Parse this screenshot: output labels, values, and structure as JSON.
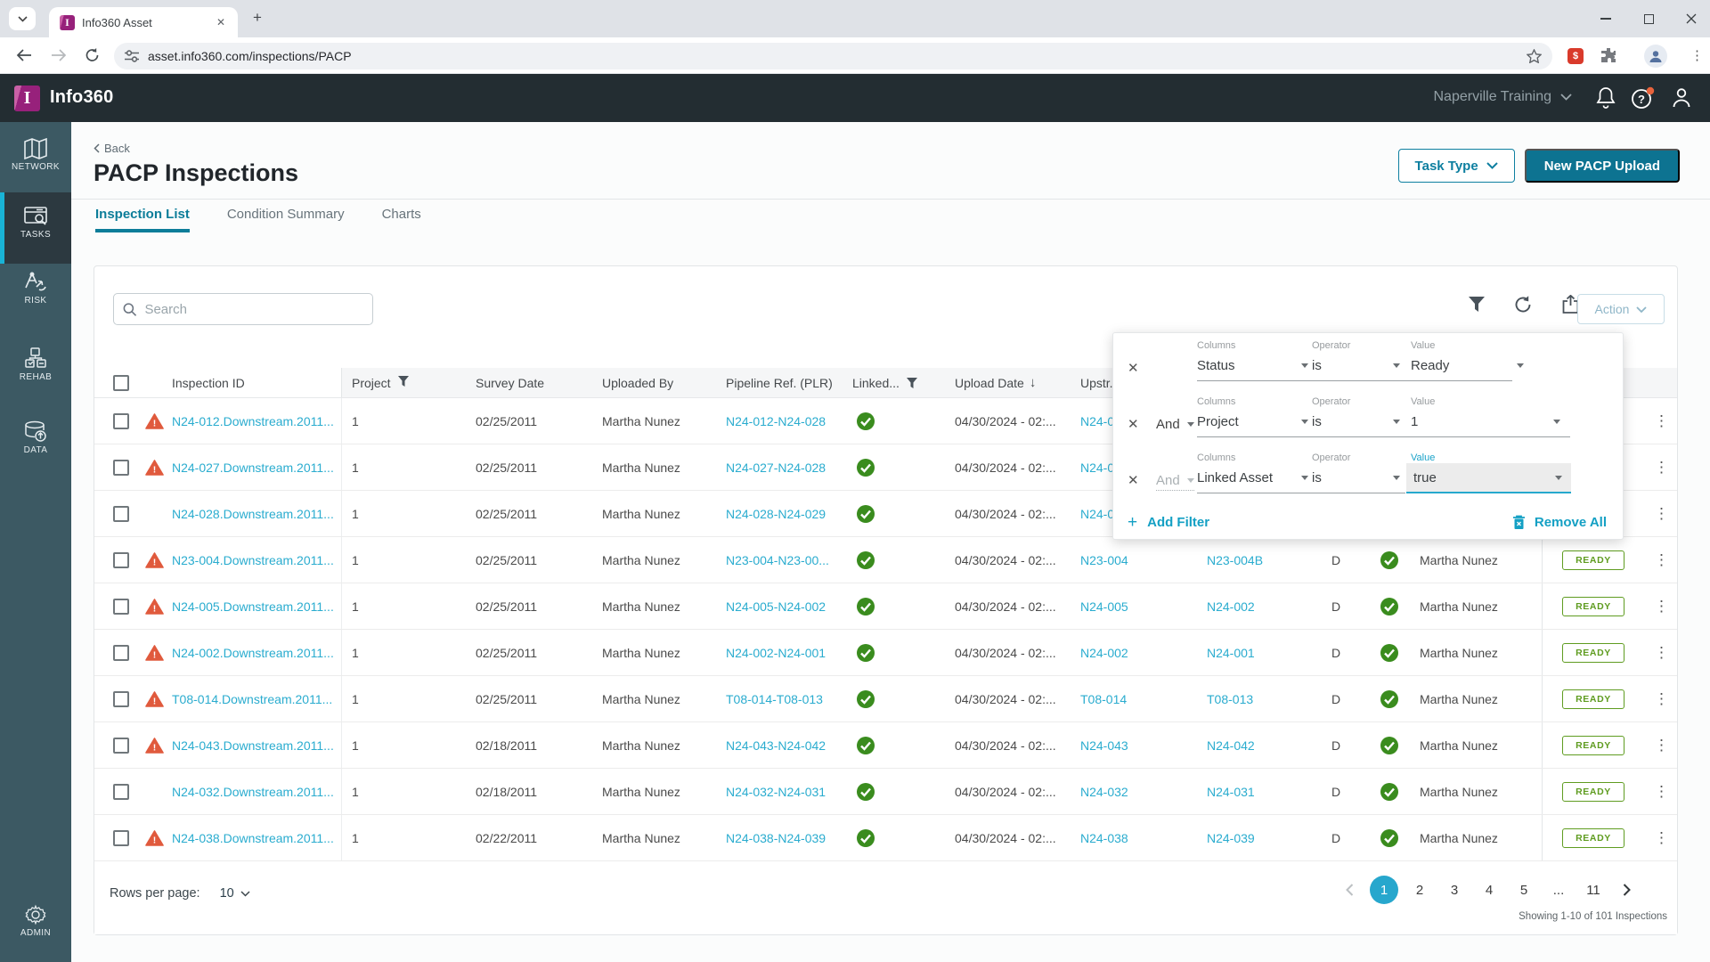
{
  "browser": {
    "tab_title": "Info360 Asset",
    "url": "asset.info360.com/inspections/PACP"
  },
  "header": {
    "brand": "Info360",
    "org": "Naperville Training"
  },
  "sidebar": {
    "items": [
      {
        "label": "NETWORK",
        "active": false
      },
      {
        "label": "TASKS",
        "active": true
      },
      {
        "label": "RISK",
        "active": false
      },
      {
        "label": "REHAB",
        "active": false
      },
      {
        "label": "DATA",
        "active": false
      }
    ],
    "admin_label": "ADMIN"
  },
  "page": {
    "back_label": "Back",
    "title": "PACP Inspections",
    "tabs": [
      "Inspection List",
      "Condition Summary",
      "Charts"
    ],
    "task_type_button": "Task Type",
    "upload_button": "New PACP Upload"
  },
  "toolbar": {
    "search_placeholder": "Search",
    "action_button": "Action"
  },
  "table": {
    "columns": [
      "Inspection ID",
      "Project",
      "Survey Date",
      "Uploaded By",
      "Pipeline Ref. (PLR)",
      "Linked...",
      "Upload Date",
      "Upstr..."
    ],
    "rows": [
      {
        "warning": true,
        "id": "N24-012.Downstream.2011...",
        "project": "1",
        "survey": "02/25/2011",
        "uploaded_by": "Martha Nunez",
        "pipeline": "N24-012-N24-028",
        "linked": true,
        "upload": "04/30/2024 - 02:...",
        "upstream": "N24-0",
        "downstream": "",
        "direction": "",
        "reviewed": false,
        "reviewer": "",
        "status": ""
      },
      {
        "warning": true,
        "id": "N24-027.Downstream.2011...",
        "project": "1",
        "survey": "02/25/2011",
        "uploaded_by": "Martha Nunez",
        "pipeline": "N24-027-N24-028",
        "linked": true,
        "upload": "04/30/2024 - 02:...",
        "upstream": "N24-0",
        "downstream": "",
        "direction": "",
        "reviewed": false,
        "reviewer": "",
        "status": ""
      },
      {
        "warning": false,
        "id": "N24-028.Downstream.2011...",
        "project": "1",
        "survey": "02/25/2011",
        "uploaded_by": "Martha Nunez",
        "pipeline": "N24-028-N24-029",
        "linked": true,
        "upload": "04/30/2024 - 02:...",
        "upstream": "N24-0",
        "downstream": "",
        "direction": "",
        "reviewed": false,
        "reviewer": "",
        "status": ""
      },
      {
        "warning": true,
        "id": "N23-004.Downstream.2011...",
        "project": "1",
        "survey": "02/25/2011",
        "uploaded_by": "Martha Nunez",
        "pipeline": "N23-004-N23-00...",
        "linked": true,
        "upload": "04/30/2024 - 02:...",
        "upstream": "N23-004",
        "downstream": "N23-004B",
        "direction": "D",
        "reviewed": true,
        "reviewer": "Martha Nunez",
        "status": "READY"
      },
      {
        "warning": true,
        "id": "N24-005.Downstream.2011...",
        "project": "1",
        "survey": "02/25/2011",
        "uploaded_by": "Martha Nunez",
        "pipeline": "N24-005-N24-002",
        "linked": true,
        "upload": "04/30/2024 - 02:...",
        "upstream": "N24-005",
        "downstream": "N24-002",
        "direction": "D",
        "reviewed": true,
        "reviewer": "Martha Nunez",
        "status": "READY"
      },
      {
        "warning": true,
        "id": "N24-002.Downstream.2011...",
        "project": "1",
        "survey": "02/25/2011",
        "uploaded_by": "Martha Nunez",
        "pipeline": "N24-002-N24-001",
        "linked": true,
        "upload": "04/30/2024 - 02:...",
        "upstream": "N24-002",
        "downstream": "N24-001",
        "direction": "D",
        "reviewed": true,
        "reviewer": "Martha Nunez",
        "status": "READY"
      },
      {
        "warning": true,
        "id": "T08-014.Downstream.2011...",
        "project": "1",
        "survey": "02/25/2011",
        "uploaded_by": "Martha Nunez",
        "pipeline": "T08-014-T08-013",
        "linked": true,
        "upload": "04/30/2024 - 02:...",
        "upstream": "T08-014",
        "downstream": "T08-013",
        "direction": "D",
        "reviewed": true,
        "reviewer": "Martha Nunez",
        "status": "READY"
      },
      {
        "warning": true,
        "id": "N24-043.Downstream.2011...",
        "project": "1",
        "survey": "02/18/2011",
        "uploaded_by": "Martha Nunez",
        "pipeline": "N24-043-N24-042",
        "linked": true,
        "upload": "04/30/2024 - 02:...",
        "upstream": "N24-043",
        "downstream": "N24-042",
        "direction": "D",
        "reviewed": true,
        "reviewer": "Martha Nunez",
        "status": "READY"
      },
      {
        "warning": false,
        "id": "N24-032.Downstream.2011...",
        "project": "1",
        "survey": "02/18/2011",
        "uploaded_by": "Martha Nunez",
        "pipeline": "N24-032-N24-031",
        "linked": true,
        "upload": "04/30/2024 - 02:...",
        "upstream": "N24-032",
        "downstream": "N24-031",
        "direction": "D",
        "reviewed": true,
        "reviewer": "Martha Nunez",
        "status": "READY"
      },
      {
        "warning": true,
        "id": "N24-038.Downstream.2011...",
        "project": "1",
        "survey": "02/22/2011",
        "uploaded_by": "Martha Nunez",
        "pipeline": "N24-038-N24-039",
        "linked": true,
        "upload": "04/30/2024 - 02:...",
        "upstream": "N24-038",
        "downstream": "N24-039",
        "direction": "D",
        "reviewed": true,
        "reviewer": "Martha Nunez",
        "status": "READY"
      }
    ]
  },
  "filter_panel": {
    "labels": {
      "columns": "Columns",
      "operator": "Operator",
      "value": "Value"
    },
    "filters": [
      {
        "and": "",
        "column": "Status",
        "operator": "is",
        "value": "Ready"
      },
      {
        "and": "And",
        "column": "Project",
        "operator": "is",
        "value": "1"
      },
      {
        "and": "And",
        "column": "Linked Asset",
        "operator": "is",
        "value": "true",
        "focused": true
      }
    ],
    "add_filter": "Add Filter",
    "remove_all": "Remove All"
  },
  "pagination": {
    "rows_per_page_label": "Rows per page:",
    "rows_per_page": "10",
    "pages": [
      "1",
      "2",
      "3",
      "4",
      "5",
      "...",
      "11"
    ],
    "active_page": "1",
    "summary": "Showing 1-10 of 101 Inspections"
  },
  "icons": {
    "close": "✕",
    "kebab": "⋮",
    "add": "+",
    "sort_desc": "↓",
    "ext_badge": "$"
  },
  "colors": {
    "accent_cyan": "#27a7cd",
    "link": "#2aaccf",
    "teal_button": "#0d7391",
    "ready_green": "#5f9c20",
    "check_green": "#3a8c1e",
    "warning_orange": "#e05a3d",
    "header_dark": "#232d32",
    "sidebar": "#3c5963",
    "brand_magenta": "#97217b"
  }
}
